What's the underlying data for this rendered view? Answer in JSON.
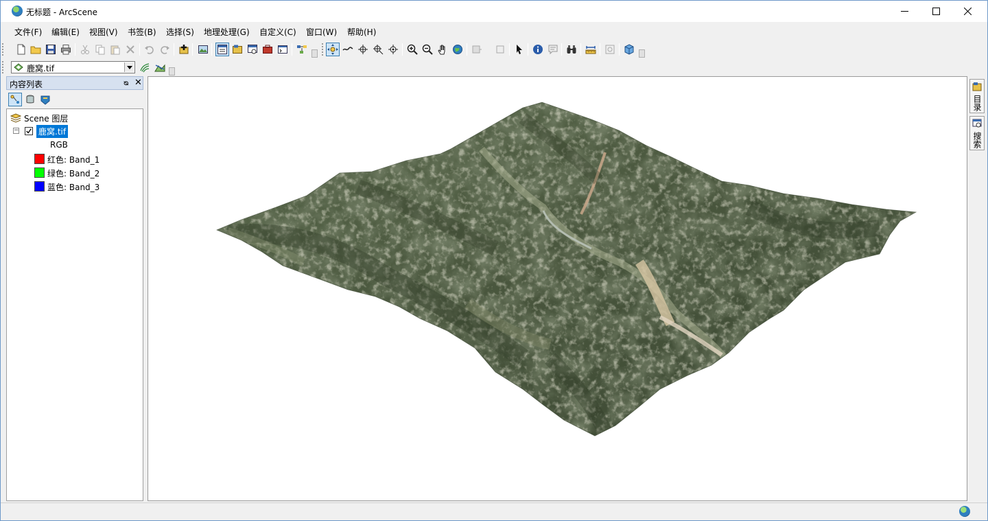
{
  "window": {
    "title": "无标题 - ArcScene"
  },
  "menu": [
    "文件(F)",
    "编辑(E)",
    "视图(V)",
    "书签(B)",
    "选择(S)",
    "地理处理(G)",
    "自定义(C)",
    "窗口(W)",
    "帮助(H)"
  ],
  "toolbar": {
    "layer_combo_value": "鹿窝.tif"
  },
  "toc": {
    "title": "内容列表",
    "scene_label": "Scene 图层",
    "layer_name": "鹿窝.tif",
    "renderer": "RGB",
    "bands": [
      {
        "label": "红色:    Band_1",
        "color": "#ff0000"
      },
      {
        "label": "绿色: Band_2",
        "color": "#00ff00"
      },
      {
        "label": "蓝色:    Band_3",
        "color": "#0000ff"
      }
    ]
  },
  "right_dock": {
    "tabs": [
      "目录",
      "搜索"
    ]
  },
  "colors": {
    "accent": "#0078d7",
    "toc_header": "#d6e1f0"
  }
}
